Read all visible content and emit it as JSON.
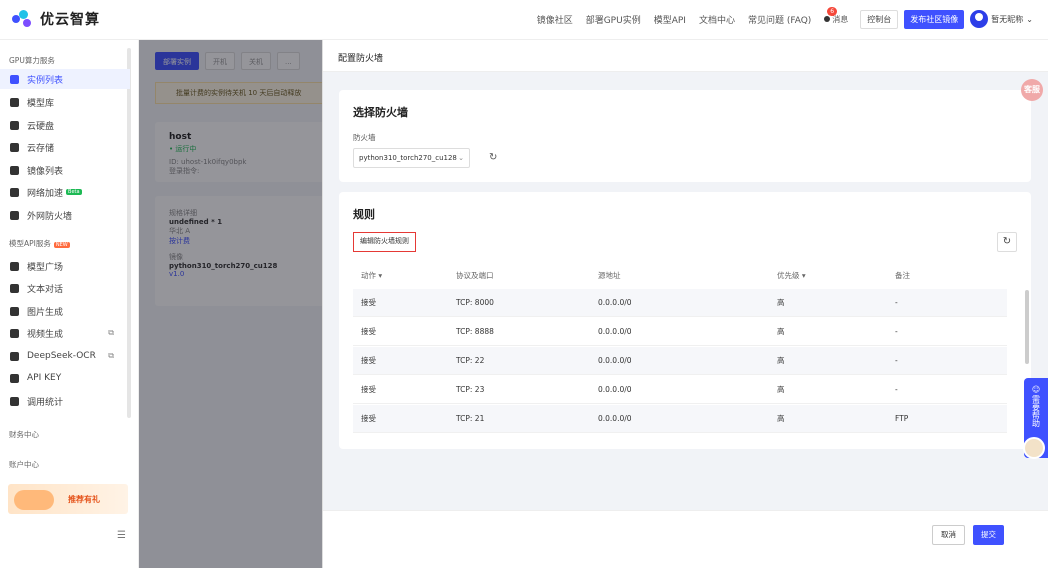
{
  "app": {
    "logo_text": "优云智算"
  },
  "nav": {
    "links": [
      "镜像社区",
      "部署GPU实例",
      "模型API",
      "文档中心",
      "常见问题 (FAQ)"
    ],
    "messages_label": "消息",
    "messages_badge": "6",
    "console_label": "控制台",
    "publish_label": "发布社区镜像",
    "user_name": "暂无昵称"
  },
  "sidebar": {
    "group_gpu": "GPU算力服务",
    "gpu_items": [
      "实例列表",
      "模型库",
      "云硬盘",
      "云存储",
      "镜像列表",
      "网络加速",
      "外网防火墙"
    ],
    "beta_badge": "Beta",
    "group_api": "模型API服务",
    "new_badge": "NEW",
    "api_items": [
      "模型广场",
      "文本对话",
      "图片生成",
      "视频生成",
      "DeepSeek-OCR",
      "API KEY",
      "调用统计"
    ],
    "group_finance": "财务中心",
    "group_account": "账户中心",
    "promo_text": "推荐有礼"
  },
  "main": {
    "toolbar": [
      "部署实例",
      "开机",
      "关机",
      "..."
    ],
    "notice": "批量计费的实例待关机 10 天后自动释放",
    "instance_name": "host",
    "instance_status": "• 运行中",
    "instance_id": "ID: uhost-1k0ifqy0bpk",
    "login_label": "登录指令:",
    "spec_label": "规格详细",
    "spec_value": "undefined * 1",
    "region": "华北 A",
    "billing": "按计费",
    "image_label": "镜像",
    "image_value": "python310_torch270_cu128",
    "image_version": "v1.0"
  },
  "drawer": {
    "title": "配置防火墙",
    "select_card_title": "选择防火墙",
    "firewall_label": "防火墙",
    "firewall_value": "python310_torch270_cu128",
    "rules_title": "规则",
    "edit_rules_label": "编辑防火墙规则",
    "columns": [
      "动作",
      "协议及端口",
      "源地址",
      "优先级",
      "备注"
    ],
    "rows": [
      {
        "action": "接受",
        "port": "TCP: 8000",
        "source": "0.0.0.0/0",
        "priority": "高",
        "remark": "-"
      },
      {
        "action": "接受",
        "port": "TCP: 8888",
        "source": "0.0.0.0/0",
        "priority": "高",
        "remark": "-"
      },
      {
        "action": "接受",
        "port": "TCP: 22",
        "source": "0.0.0.0/0",
        "priority": "高",
        "remark": "-"
      },
      {
        "action": "接受",
        "port": "TCP: 23",
        "source": "0.0.0.0/0",
        "priority": "高",
        "remark": "-"
      },
      {
        "action": "接受",
        "port": "TCP: 21",
        "source": "0.0.0.0/0",
        "priority": "高",
        "remark": "FTP"
      }
    ],
    "cancel_label": "取消",
    "submit_label": "提交"
  },
  "floating": {
    "help_label": "需要帮助",
    "top_badge": "客服"
  },
  "colors": {
    "accent": "#3f51ff",
    "danger": "#e53935"
  }
}
